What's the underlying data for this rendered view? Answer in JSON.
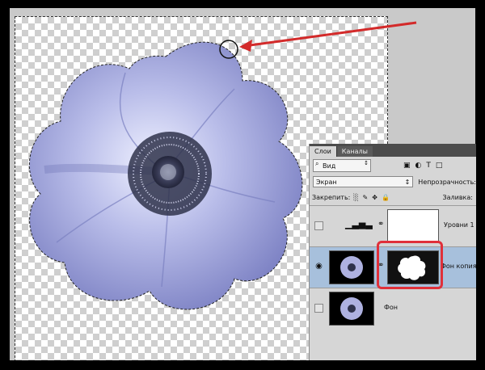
{
  "panel": {
    "tabs": [
      "Слои",
      "Каналы"
    ],
    "kind_filter": "Вид",
    "blend_mode": "Экран",
    "opacity_label": "Непрозрачность:",
    "lock_label": "Закрепить:",
    "fill_label": "Заливка:"
  },
  "layers": [
    {
      "name": "Уровни 1",
      "visible": false
    },
    {
      "name": "Фон копия",
      "visible": true,
      "selected": true
    },
    {
      "name": "Фон",
      "visible": false
    }
  ],
  "colors": {
    "flower_petal": "#a9acde",
    "flower_shadow": "#6d72b5",
    "selection_accent": "#a7c0dc",
    "annotation_red": "#e0303a"
  }
}
